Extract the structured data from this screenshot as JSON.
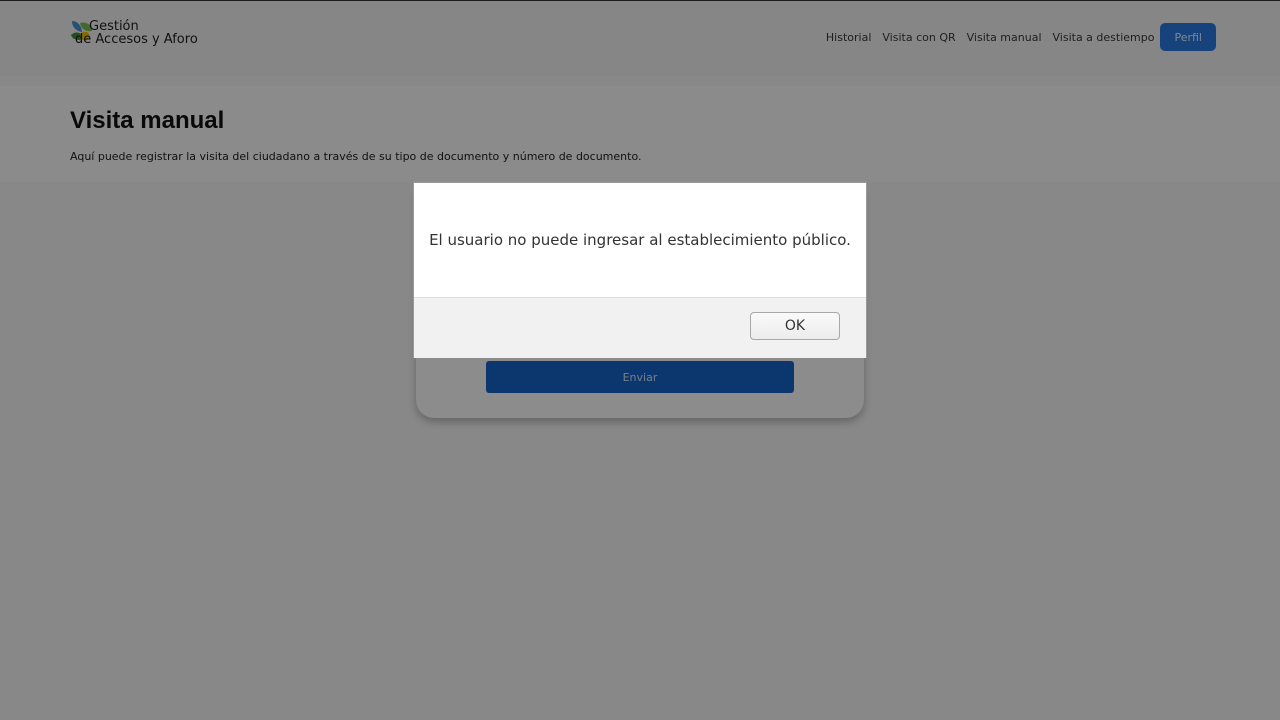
{
  "header": {
    "logo": {
      "line1": "Gestión",
      "line2": "de Accesos y Aforo",
      "icon": "leaf-logo-icon"
    },
    "nav": {
      "items": [
        {
          "label": "Historial"
        },
        {
          "label": "Visita con QR"
        },
        {
          "label": "Visita manual"
        },
        {
          "label": "Visita a destiempo"
        }
      ],
      "profile_label": "Perfil"
    }
  },
  "main": {
    "title": "Visita manual",
    "description": "Aquí puede registrar la visita del ciudadano a través de su tipo de documento y número de documento.",
    "form": {
      "submit_label": "Enviar"
    }
  },
  "dialog": {
    "message": "El usuario no puede ingresar al establecimiento público.",
    "ok_label": "OK"
  },
  "colors": {
    "accent": "#2b7be4",
    "submit": "#1565c8",
    "overlay": "rgba(0,0,0,0.45)"
  }
}
